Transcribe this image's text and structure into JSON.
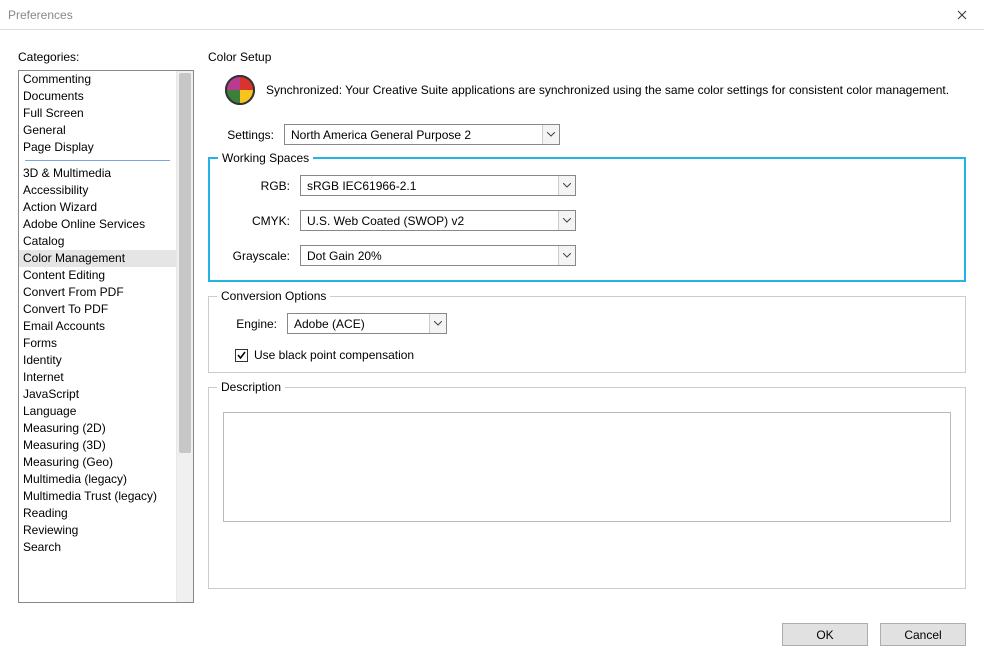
{
  "window": {
    "title": "Preferences"
  },
  "sidebar": {
    "label": "Categories:",
    "group1": [
      "Commenting",
      "Documents",
      "Full Screen",
      "General",
      "Page Display"
    ],
    "group2": [
      "3D & Multimedia",
      "Accessibility",
      "Action Wizard",
      "Adobe Online Services",
      "Catalog",
      "Color Management",
      "Content Editing",
      "Convert From PDF",
      "Convert To PDF",
      "Email Accounts",
      "Forms",
      "Identity",
      "Internet",
      "JavaScript",
      "Language",
      "Measuring (2D)",
      "Measuring (3D)",
      "Measuring (Geo)",
      "Multimedia (legacy)",
      "Multimedia Trust (legacy)",
      "Reading",
      "Reviewing",
      "Search"
    ],
    "selected": "Color Management"
  },
  "main": {
    "section": "Color Setup",
    "sync_text": "Synchronized: Your Creative Suite applications are synchronized using the same color settings for consistent color management.",
    "settings_label": "Settings:",
    "settings_value": "North America General Purpose 2",
    "working_spaces": {
      "legend": "Working Spaces",
      "rgb_label": "RGB:",
      "rgb_value": "sRGB IEC61966-2.1",
      "cmyk_label": "CMYK:",
      "cmyk_value": "U.S. Web Coated (SWOP) v2",
      "gray_label": "Grayscale:",
      "gray_value": "Dot Gain 20%"
    },
    "conversion": {
      "legend": "Conversion Options",
      "engine_label": "Engine:",
      "engine_value": "Adobe (ACE)",
      "black_point": "Use black point compensation",
      "black_point_checked": true
    },
    "description": {
      "legend": "Description"
    }
  },
  "buttons": {
    "ok": "OK",
    "cancel": "Cancel"
  }
}
